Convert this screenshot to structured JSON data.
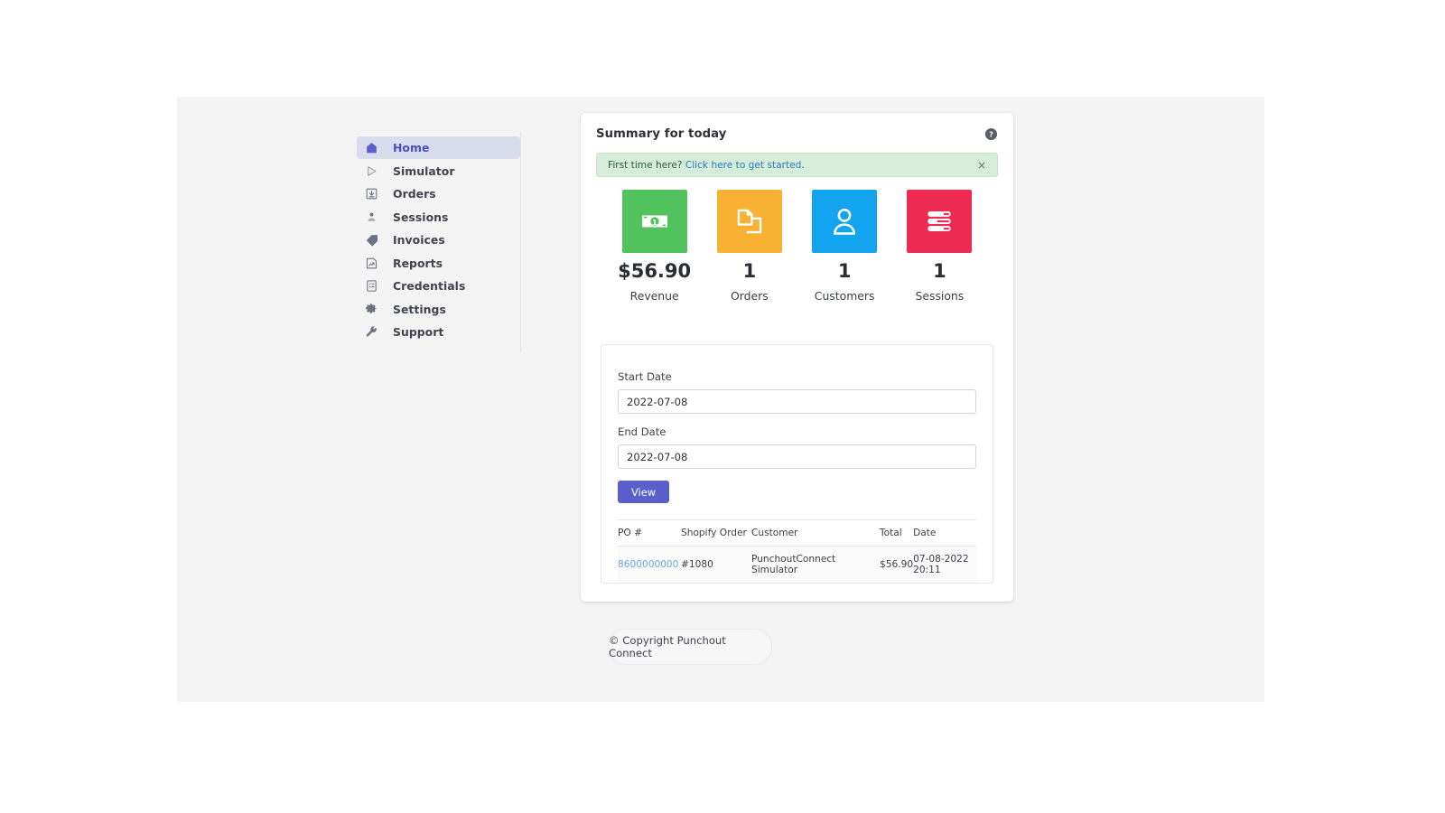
{
  "sidebar": {
    "items": [
      {
        "label": "Home",
        "icon": "home-icon",
        "active": true
      },
      {
        "label": "Simulator",
        "icon": "play-icon",
        "active": false
      },
      {
        "label": "Orders",
        "icon": "download-box-icon",
        "active": false
      },
      {
        "label": "Sessions",
        "icon": "person-icon",
        "active": false
      },
      {
        "label": "Invoices",
        "icon": "tag-icon",
        "active": false
      },
      {
        "label": "Reports",
        "icon": "chart-page-icon",
        "active": false
      },
      {
        "label": "Credentials",
        "icon": "clipboard-icon",
        "active": false
      },
      {
        "label": "Settings",
        "icon": "gear-icon",
        "active": false
      },
      {
        "label": "Support",
        "icon": "wrench-icon",
        "active": false
      }
    ]
  },
  "card": {
    "title": "Summary for today",
    "help_icon": "help-circle-icon"
  },
  "alert": {
    "prefix": "First time here? ",
    "link": "Click here to get started",
    "suffix": ".",
    "close_label": "×",
    "background": "#d6edda",
    "text_color": "#2b6036",
    "link_color": "#2a7bb8"
  },
  "stats": [
    {
      "value": "$56.90",
      "label": "Revenue",
      "icon": "money-bill-icon",
      "color": "#52c35c"
    },
    {
      "value": "1",
      "label": "Orders",
      "icon": "copy-files-icon",
      "color": "#f8b133"
    },
    {
      "value": "1",
      "label": "Customers",
      "icon": "user-icon",
      "color": "#13a4f0"
    },
    {
      "value": "1",
      "label": "Sessions",
      "icon": "server-list-icon",
      "color": "#ee2b52"
    }
  ],
  "form": {
    "start_date_label": "Start Date",
    "start_date_value": "2022-07-08",
    "start_date_placeholder": "YYYY-MM-DD",
    "end_date_label": "End Date",
    "end_date_value": "2022-07-08",
    "end_date_placeholder": "YYYY-MM-DD",
    "view_button": "View",
    "button_color": "#5a5fcb"
  },
  "table": {
    "columns": [
      "PO #",
      "Shopify Order",
      "Customer",
      "Total",
      "Date"
    ],
    "rows": [
      {
        "po": "8600000000",
        "shopify_order": "#1080",
        "customer": "PunchoutConnect Simulator",
        "total": "$56.90",
        "date": "07-08-2022 20:11"
      }
    ]
  },
  "footer": {
    "text": "© Copyright Punchout Connect"
  }
}
